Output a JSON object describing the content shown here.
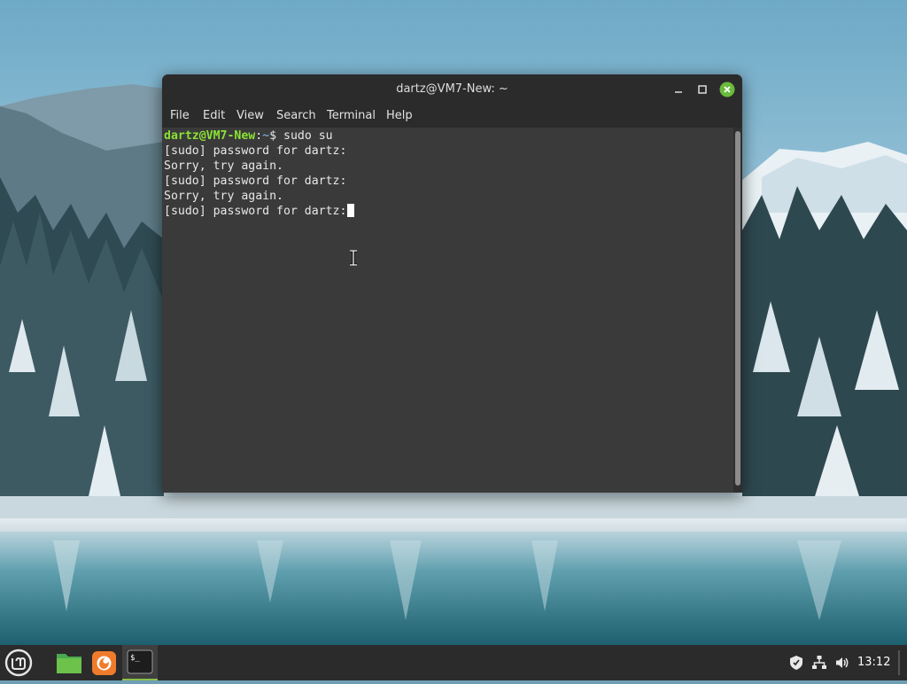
{
  "window": {
    "title": "dartz@VM7-New: ~"
  },
  "menubar": {
    "items": [
      {
        "label": "File"
      },
      {
        "label": "Edit"
      },
      {
        "label": "View"
      },
      {
        "label": "Search"
      },
      {
        "label": "Terminal"
      },
      {
        "label": "Help"
      }
    ]
  },
  "terminal": {
    "prompt_user": "dartz@VM7-New",
    "prompt_sep": ":",
    "prompt_path": "~",
    "prompt_symbol": "$ ",
    "command": "sudo su",
    "lines": [
      "[sudo] password for dartz:",
      "Sorry, try again.",
      "[sudo] password for dartz:",
      "Sorry, try again.",
      "[sudo] password for dartz:"
    ]
  },
  "taskbar": {
    "menu_icon": "linux-mint-icon",
    "apps": [
      {
        "name": "files-icon"
      },
      {
        "name": "firefox-icon"
      },
      {
        "name": "terminal-icon",
        "label": "$_",
        "active": true
      }
    ],
    "tray": [
      "shield-icon",
      "network-icon",
      "volume-icon"
    ],
    "clock": "13:12"
  },
  "colors": {
    "prompt_user": "#8ae234",
    "prompt_path": "#729fcf",
    "close_button": "#6aba3c",
    "terminal_bg": "#3a3a3a",
    "taskbar_bg": "#2b2b2b"
  }
}
